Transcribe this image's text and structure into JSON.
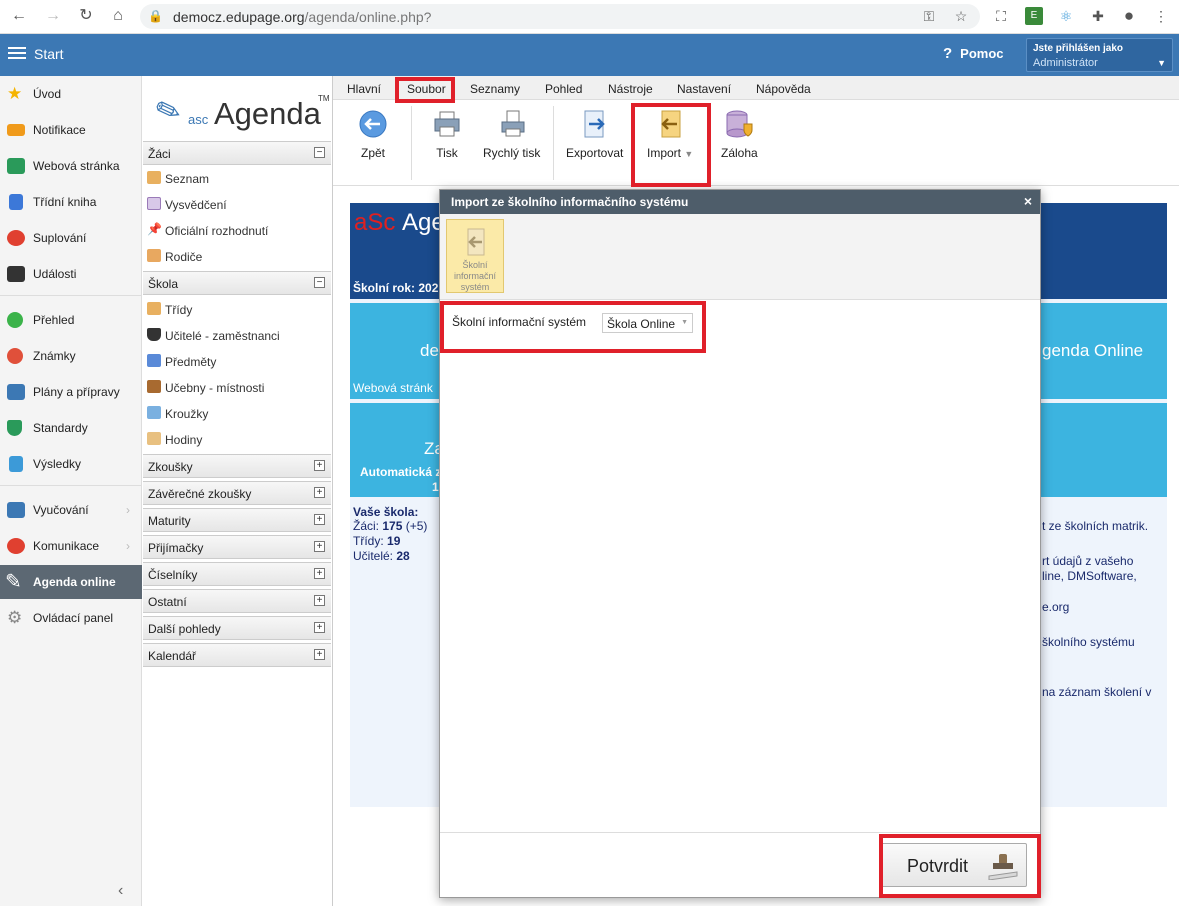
{
  "browser": {
    "url_host": "democz.edupage.org",
    "url_path": "/agenda/online.php?"
  },
  "topbar": {
    "start_label": "Start",
    "help_label": "Pomoc",
    "user_line1": "Jste přihlášen jako",
    "user_line2": "Administrátor"
  },
  "left_nav": {
    "items": [
      {
        "label": "Úvod",
        "icon": "star-icon",
        "color": "#f5b400"
      },
      {
        "label": "Notifikace",
        "icon": "envelope-icon",
        "color": "#f09a1a"
      },
      {
        "label": "Webová stránka",
        "icon": "house-icon",
        "color": "#2a9a5a"
      },
      {
        "label": "Třídní kniha",
        "icon": "book-icon",
        "color": "#3c78d8"
      },
      {
        "label": "Suplování",
        "icon": "person-icon",
        "color": "#e04030"
      },
      {
        "label": "Události",
        "icon": "calendar-icon",
        "color": "#333333"
      },
      {
        "label": "Přehled",
        "icon": "check-circle-icon",
        "color": "#3bb34a"
      },
      {
        "label": "Známky",
        "icon": "grade-icon",
        "color": "#e0503a"
      },
      {
        "label": "Plány a přípravy",
        "icon": "briefcase-icon",
        "color": "#3c78b4"
      },
      {
        "label": "Standardy",
        "icon": "shield-icon",
        "color": "#2a9a5a"
      },
      {
        "label": "Výsledky",
        "icon": "bar-chart-icon",
        "color": "#3c9ad8"
      },
      {
        "label": "Vyučování",
        "icon": "board-icon",
        "color": "#3c78b4"
      },
      {
        "label": "Komunikace",
        "icon": "chat-icon",
        "color": "#e04030"
      },
      {
        "label": "Agenda online",
        "icon": "pen-icon",
        "color": "#ffffff"
      },
      {
        "label": "Ovládací panel",
        "icon": "gear-icon",
        "color": "#888888"
      }
    ]
  },
  "agenda_logo": {
    "asc": "asc",
    "name": "Agenda",
    "tm": "TM"
  },
  "sidebar": {
    "sections": {
      "zaci": "Žáci",
      "skola": "Škola",
      "zkousky": "Zkoušky",
      "zaverecne": "Závěrečné zkoušky",
      "maturity": "Maturity",
      "prijimacky": "Přijímačky",
      "ciselniky": "Číselníky",
      "ostatni": "Ostatní",
      "dalsi": "Další pohledy",
      "kalendar": "Kalendář"
    },
    "zaci_items": [
      "Seznam",
      "Vysvědčení",
      "Oficiální rozhodnutí",
      "Rodiče"
    ],
    "skola_items": [
      "Třídy",
      "Učitelé - zaměstnanci",
      "Předměty",
      "Učebny - místnosti",
      "Kroužky",
      "Hodiny"
    ]
  },
  "menubar": {
    "tabs": [
      "Hlavní",
      "Soubor",
      "Seznamy",
      "Pohled",
      "Nástroje",
      "Nastavení",
      "Nápověda"
    ]
  },
  "ribbon": {
    "back": "Zpět",
    "print": "Tisk",
    "quick_print": "Rychlý tisk",
    "export": "Exportovat",
    "import": "Import",
    "backup": "Záloha"
  },
  "background_content": {
    "asc": "aSc",
    "agenda_partial": "Age",
    "school_year": "Školní rok: 202",
    "left_partial_de": "de",
    "right_partial_online": "genda Online",
    "web_partial": "Webová stránk",
    "za_partial": "Za",
    "auto_partial": "Automatická z",
    "num_partial": "1",
    "school_title": "Vaše škola:",
    "pupils_label": "Žáci:",
    "pupils_value": "175",
    "pupils_extra": "(+5)",
    "classes_label": "Třídy:",
    "classes_value": "19",
    "teachers_label": "Učitelé:",
    "teachers_value": "28",
    "right_lines": [
      "t ze školních matrik.",
      "rt údajů z vašeho",
      "line, DMSoftware,",
      "e.org",
      "školního systému",
      "na záznam školení v"
    ]
  },
  "dialog": {
    "title": "Import ze školního informačního systému",
    "close": "×",
    "tool_button": "Školní informační systém",
    "field_label": "Školní informační systém",
    "field_value": "Škola Online",
    "confirm": "Potvrdit"
  },
  "colors": {
    "topbar": "#3c78b4",
    "highlight": "#e0202a",
    "dialog_title": "#4e5d6a"
  }
}
